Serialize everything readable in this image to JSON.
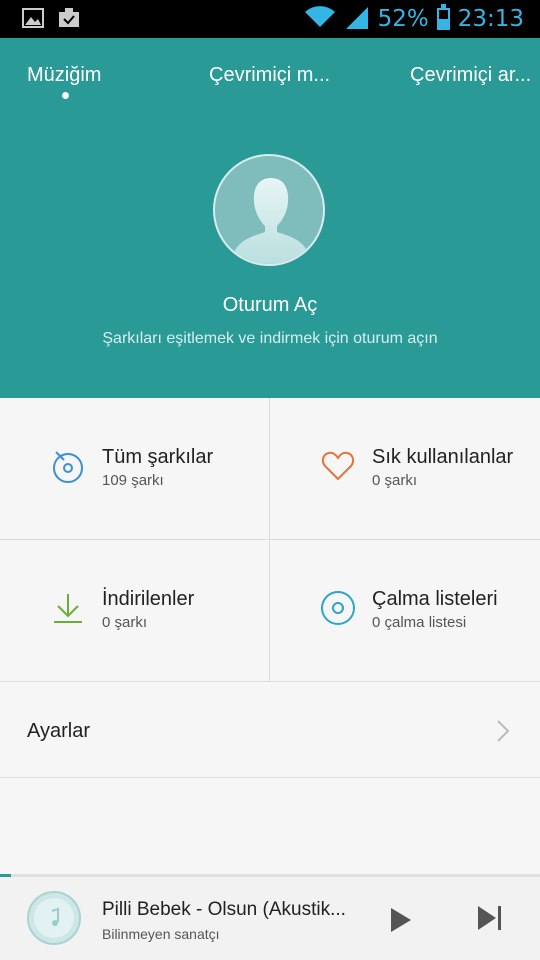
{
  "status_bar": {
    "battery_percent": "52%",
    "battery_level": 0.52,
    "time": "23:13",
    "left_icons": [
      "image-icon",
      "clipboard-check-icon"
    ],
    "right_icons": [
      "wifi-icon",
      "signal-icon",
      "battery-icon"
    ],
    "accent_color": "#35b5e5"
  },
  "header": {
    "background_color": "#2a9a97",
    "tabs": [
      {
        "label": "Müziğim",
        "selected": true
      },
      {
        "label": "Çevrimiçi m..."
      },
      {
        "label": "Çevrimiçi ar..."
      }
    ],
    "login_title": "Oturum Aç",
    "login_subtitle": "Şarkıları eşitlemek ve indirmek için oturum açın"
  },
  "grid": [
    {
      "icon": "all-songs-icon",
      "title": "Tüm şarkılar",
      "subtitle": "109 şarkı"
    },
    {
      "icon": "heart-icon",
      "title": "Sık kullanılanlar",
      "subtitle": "0 şarkı"
    },
    {
      "icon": "download-icon",
      "title": "İndirilenler",
      "subtitle": "0 şarkı"
    },
    {
      "icon": "disc-icon",
      "title": "Çalma listeleri",
      "subtitle": "0 çalma listesi"
    }
  ],
  "settings": {
    "label": "Ayarlar"
  },
  "player": {
    "song": "Pilli Bebek - Olsun (Akustik...",
    "artist": "Bilinmeyen sanatçı",
    "progress": 0.02
  }
}
